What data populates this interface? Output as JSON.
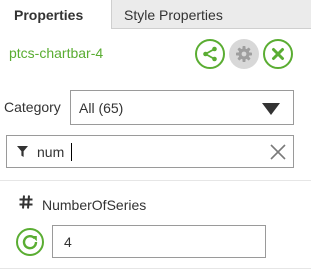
{
  "tabs": [
    {
      "label": "Properties",
      "active": true
    },
    {
      "label": "Style Properties",
      "active": false
    }
  ],
  "widget": {
    "name": "ptcs-chartbar-4",
    "actions": [
      {
        "icon": "share-icon"
      },
      {
        "icon": "gear-icon"
      },
      {
        "icon": "close-icon"
      }
    ]
  },
  "category": {
    "label": "Category",
    "selected": "All (65)"
  },
  "filter": {
    "value": "num",
    "icon": "filter-icon",
    "clear_icon": "clear-icon"
  },
  "property": {
    "type_icon": "hash-icon",
    "name": "NumberOfSeries",
    "value": "4",
    "reset_icon": "reset-icon"
  },
  "colors": {
    "accent": "#5aad32",
    "inactive_tab": "#ebebeb",
    "gear_bg": "#d8d8d8",
    "border": "#9a9a9a"
  }
}
